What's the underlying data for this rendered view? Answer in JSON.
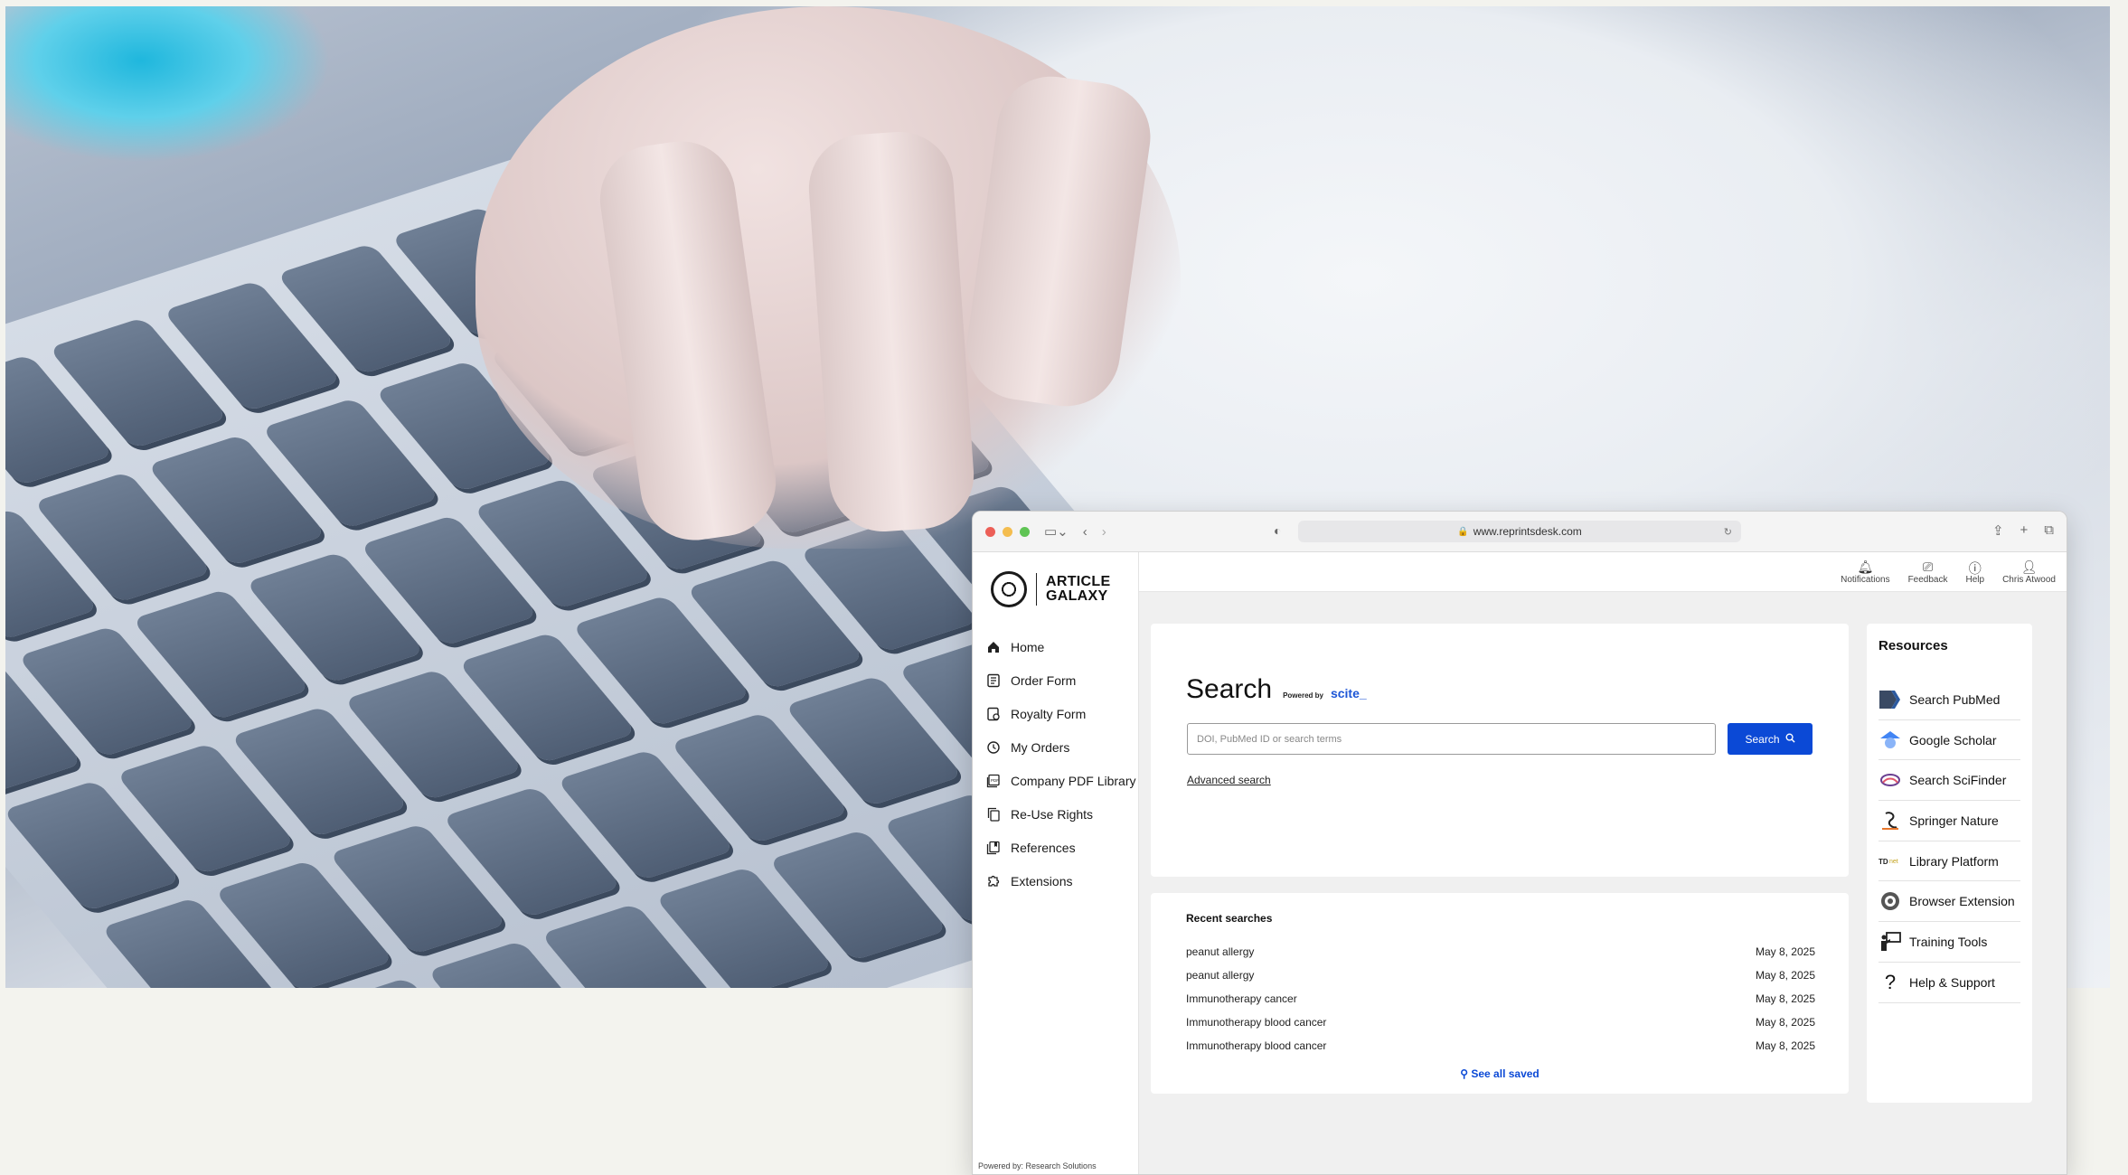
{
  "browser": {
    "url": "www.reprintsdesk.com"
  },
  "sidebar": {
    "logo_line1": "ARTICLE",
    "logo_line2": "GALAXY",
    "items": [
      {
        "label": "Home",
        "icon": "home-icon"
      },
      {
        "label": "Order Form",
        "icon": "form-icon"
      },
      {
        "label": "Royalty Form",
        "icon": "royalty-icon"
      },
      {
        "label": "My Orders",
        "icon": "history-icon"
      },
      {
        "label": "Company PDF Library",
        "icon": "pdf-icon"
      },
      {
        "label": "Re-Use Rights",
        "icon": "copy-icon"
      },
      {
        "label": "References",
        "icon": "references-icon"
      },
      {
        "label": "Extensions",
        "icon": "puzzle-icon"
      }
    ],
    "powered_by": "Powered by: Research Solutions"
  },
  "topbar": {
    "notifications": "Notifications",
    "feedback": "Feedback",
    "help": "Help",
    "user": "Chris Atwood"
  },
  "search": {
    "title": "Search",
    "powered_by": "Powered by",
    "scite": "scite_",
    "placeholder": "DOI, PubMed ID or search terms",
    "button_label": "Search",
    "advanced_link": "Advanced search"
  },
  "recent": {
    "title": "Recent searches",
    "rows": [
      {
        "query": "peanut allergy",
        "date": "May 8, 2025"
      },
      {
        "query": "peanut allergy",
        "date": "May 8, 2025"
      },
      {
        "query": "Immunotherapy cancer",
        "date": "May 8, 2025"
      },
      {
        "query": "Immunotherapy blood cancer",
        "date": "May 8, 2025"
      },
      {
        "query": "Immunotherapy blood cancer",
        "date": "May 8, 2025"
      }
    ],
    "see_all": "See all saved"
  },
  "resources": {
    "title": "Resources",
    "items": [
      {
        "label": "Search PubMed",
        "icon": "pubmed-icon"
      },
      {
        "label": "Google Scholar",
        "icon": "google-scholar-icon"
      },
      {
        "label": "Search SciFinder",
        "icon": "scifinder-icon"
      },
      {
        "label": "Springer Nature",
        "icon": "springer-icon"
      },
      {
        "label": "Library Platform",
        "icon": "library-platform-icon"
      },
      {
        "label": "Browser Extension",
        "icon": "browser-extension-icon"
      },
      {
        "label": "Training Tools",
        "icon": "training-icon"
      },
      {
        "label": "Help & Support",
        "icon": "help-support-icon"
      }
    ]
  },
  "colors": {
    "accent": "#0b49d6",
    "background": "#f3f3ee"
  }
}
